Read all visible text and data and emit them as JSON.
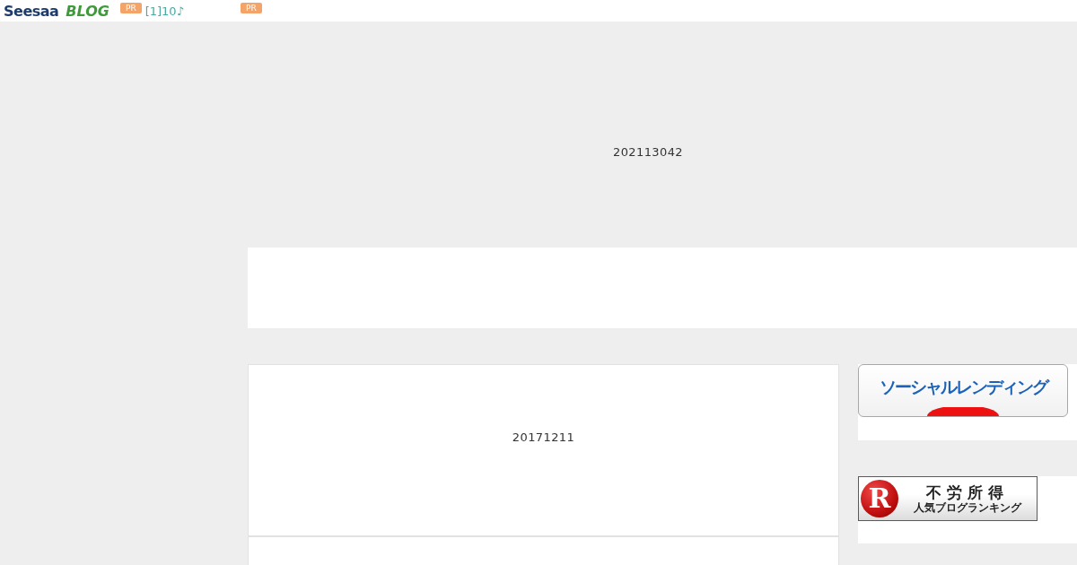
{
  "header": {
    "logo": {
      "name": "Seesaa",
      "suffix": "BLOG"
    },
    "ads": [
      {
        "label": "PR",
        "text": "[1]10♪"
      },
      {
        "label": "PR"
      }
    ]
  },
  "blog": {
    "title": "202113042"
  },
  "article": {
    "date": "20171211"
  },
  "sidebar": {
    "banners": [
      {
        "kind": "lending",
        "title": "ソーシャルレンディング"
      },
      {
        "kind": "ranking",
        "mark": "R",
        "title": "不労所得",
        "subtitle": "人気ブログランキング"
      }
    ]
  }
}
